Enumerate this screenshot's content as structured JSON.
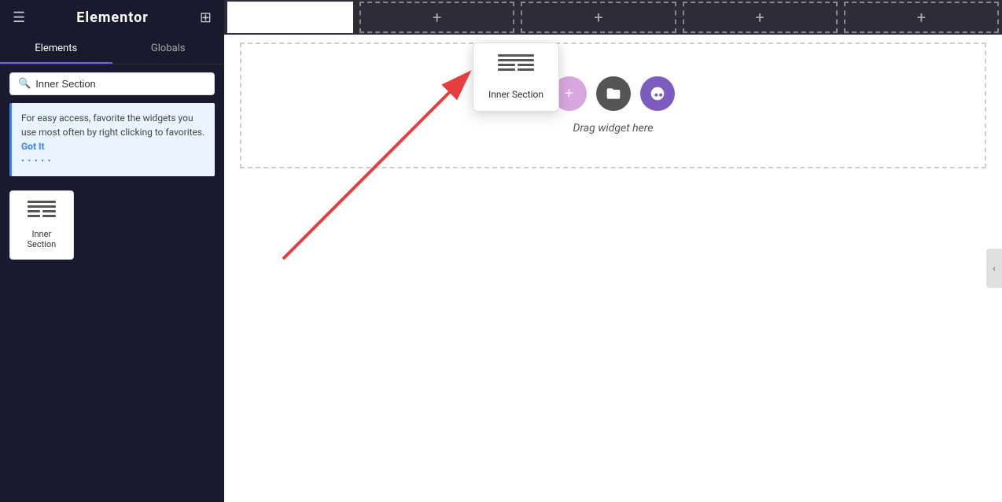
{
  "app": {
    "logo": "elementor",
    "title": "Elementor"
  },
  "sidebar": {
    "tabs": [
      {
        "id": "elements",
        "label": "Elements",
        "active": true
      },
      {
        "id": "globals",
        "label": "Globals",
        "active": false
      }
    ],
    "search": {
      "placeholder": "Inner Section",
      "value": "Inner Section"
    },
    "tip": {
      "text": "For easy access, favorite the widgets you use most often by right clicking to favorites.",
      "link_text": "Got It",
      "dots": "• • • • •"
    },
    "widgets": [
      {
        "id": "inner-section",
        "label": "Inner Section"
      }
    ]
  },
  "canvas": {
    "sections": [
      {
        "id": "sec1",
        "type": "active"
      },
      {
        "id": "sec2",
        "type": "add"
      },
      {
        "id": "sec3",
        "type": "add"
      },
      {
        "id": "sec4",
        "type": "add"
      },
      {
        "id": "sec5",
        "type": "add"
      }
    ],
    "drop_zone": {
      "label": "Drag widget here"
    },
    "buttons": [
      {
        "id": "add",
        "symbol": "+",
        "style": "plus"
      },
      {
        "id": "folder",
        "symbol": "🗀",
        "style": "folder"
      },
      {
        "id": "smiley",
        "symbol": "☺",
        "style": "smiley"
      }
    ]
  },
  "widget_popup": {
    "label": "Inner Section"
  },
  "icons": {
    "hamburger": "☰",
    "grid": "⊞",
    "search": "🔍",
    "chevron_left": "‹"
  }
}
